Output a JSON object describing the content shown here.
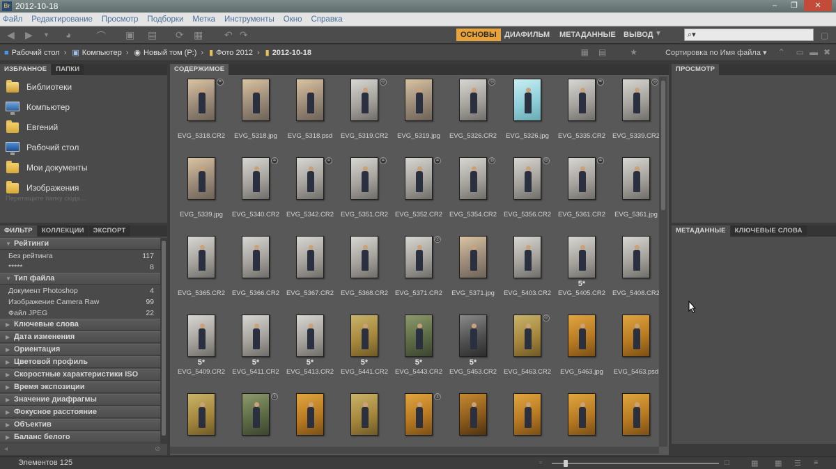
{
  "window": {
    "title": "2012-10-18",
    "app_icon": "Br"
  },
  "menu": [
    "Файл",
    "Редактирование",
    "Просмотр",
    "Подборки",
    "Метка",
    "Инструменты",
    "Окно",
    "Справка"
  ],
  "workspaces": [
    "ОСНОВЫ",
    "ДИАФИЛЬМ",
    "МЕТАДАННЫЕ",
    "ВЫВОД"
  ],
  "active_workspace": "ОСНОВЫ",
  "search": {
    "placeholder": ""
  },
  "path": [
    "Рабочий стол",
    "Компьютер",
    "Новый том (P:)",
    "Фото 2012",
    "2012-10-18"
  ],
  "sort_label": "Сортировка по Имя файла",
  "favorites_tabs": [
    "ИЗБРАННОЕ",
    "ПАПКИ"
  ],
  "favorites": [
    {
      "label": "Библиотеки",
      "icon": "libraries-icon"
    },
    {
      "label": "Компьютер",
      "icon": "computer-icon"
    },
    {
      "label": "Евгений",
      "icon": "user-folder-icon"
    },
    {
      "label": "Рабочий стол",
      "icon": "desktop-icon"
    },
    {
      "label": "Мои документы",
      "icon": "documents-icon"
    },
    {
      "label": "Изображения",
      "icon": "pictures-icon"
    }
  ],
  "favorites_hint": "Перетащите папку сюда...",
  "filter_tabs": [
    "ФИЛЬТР",
    "КОЛЛЕКЦИИ",
    "ЭКСПОРТ"
  ],
  "filter": {
    "ratings": {
      "title": "Рейтинги",
      "rows": [
        {
          "label": "Без рейтинга",
          "count": "117"
        },
        {
          "label": "*****",
          "count": "8"
        }
      ]
    },
    "file_type": {
      "title": "Тип файла",
      "rows": [
        {
          "label": "Документ Photoshop",
          "count": "4"
        },
        {
          "label": "Изображение Camera Raw",
          "count": "99"
        },
        {
          "label": "Файл JPEG",
          "count": "22"
        }
      ]
    },
    "collapsed": [
      "Ключевые слова",
      "Дата изменения",
      "Ориентация",
      "Цветовой профиль",
      "Скоростные характеристики ISO",
      "Время экспозиции",
      "Значение диафрагмы",
      "Фокусное расстояние",
      "Объектив",
      "Баланс белого"
    ]
  },
  "content_tab": "СОДЕРЖИМОЕ",
  "thumbnails": [
    {
      "name": "EVG_5318.CR2",
      "tone": "warm",
      "badge": "crop",
      "stars": ""
    },
    {
      "name": "EVG_5318.jpg",
      "tone": "warm",
      "badge": "",
      "stars": ""
    },
    {
      "name": "EVG_5318.psd",
      "tone": "warm",
      "badge": "",
      "stars": ""
    },
    {
      "name": "EVG_5319.CR2",
      "tone": "neutral",
      "badge": "dev",
      "stars": ""
    },
    {
      "name": "EVG_5319.jpg",
      "tone": "warm",
      "badge": "",
      "stars": ""
    },
    {
      "name": "EVG_5326.CR2",
      "tone": "neutral",
      "badge": "dev",
      "stars": ""
    },
    {
      "name": "EVG_5326.jpg",
      "tone": "cyan",
      "badge": "",
      "stars": ""
    },
    {
      "name": "EVG_5335.CR2",
      "tone": "neutral",
      "badge": "crop",
      "stars": ""
    },
    {
      "name": "EVG_5339.CR2",
      "tone": "neutral",
      "badge": "dev",
      "stars": ""
    },
    {
      "name": "EVG_5339.jpg",
      "tone": "warm",
      "badge": "",
      "stars": ""
    },
    {
      "name": "EVG_5340.CR2",
      "tone": "neutral",
      "badge": "crop",
      "stars": ""
    },
    {
      "name": "EVG_5342.CR2",
      "tone": "neutral",
      "badge": "crop",
      "stars": ""
    },
    {
      "name": "EVG_5351.CR2",
      "tone": "neutral",
      "badge": "crop",
      "stars": ""
    },
    {
      "name": "EVG_5352.CR2",
      "tone": "neutral",
      "badge": "crop",
      "stars": ""
    },
    {
      "name": "EVG_5354.CR2",
      "tone": "neutral",
      "badge": "dev",
      "stars": ""
    },
    {
      "name": "EVG_5356.CR2",
      "tone": "neutral",
      "badge": "dev",
      "stars": ""
    },
    {
      "name": "EVG_5361.CR2",
      "tone": "neutral",
      "badge": "crop",
      "stars": ""
    },
    {
      "name": "EVG_5361.jpg",
      "tone": "neutral",
      "badge": "",
      "stars": ""
    },
    {
      "name": "EVG_5365.CR2",
      "tone": "neutral",
      "badge": "",
      "stars": ""
    },
    {
      "name": "EVG_5366.CR2",
      "tone": "neutral",
      "badge": "",
      "stars": ""
    },
    {
      "name": "EVG_5367.CR2",
      "tone": "neutral",
      "badge": "",
      "stars": ""
    },
    {
      "name": "EVG_5368.CR2",
      "tone": "neutral",
      "badge": "",
      "stars": ""
    },
    {
      "name": "EVG_5371.CR2",
      "tone": "neutral",
      "badge": "dev",
      "stars": ""
    },
    {
      "name": "EVG_5371.jpg",
      "tone": "warm",
      "badge": "",
      "stars": ""
    },
    {
      "name": "EVG_5403.CR2",
      "tone": "neutral",
      "badge": "",
      "stars": ""
    },
    {
      "name": "EVG_5405.CR2",
      "tone": "neutral",
      "badge": "",
      "stars": "5*"
    },
    {
      "name": "EVG_5408.CR2",
      "tone": "neutral",
      "badge": "",
      "stars": ""
    },
    {
      "name": "EVG_5409.CR2",
      "tone": "neutral",
      "badge": "",
      "stars": "5*"
    },
    {
      "name": "EVG_5411.CR2",
      "tone": "neutral",
      "badge": "",
      "stars": "5*"
    },
    {
      "name": "EVG_5413.CR2",
      "tone": "neutral",
      "badge": "",
      "stars": "5*"
    },
    {
      "name": "EVG_5441.CR2",
      "tone": "autumn",
      "badge": "",
      "stars": "5*"
    },
    {
      "name": "EVG_5443.CR2",
      "tone": "green",
      "badge": "",
      "stars": "5*"
    },
    {
      "name": "EVG_5453.CR2",
      "tone": "dark",
      "badge": "",
      "stars": "5*"
    },
    {
      "name": "EVG_5463.CR2",
      "tone": "autumn",
      "badge": "dev",
      "stars": ""
    },
    {
      "name": "EVG_5463.jpg",
      "tone": "orange",
      "badge": "",
      "stars": ""
    },
    {
      "name": "EVG_5463.psd",
      "tone": "orange",
      "badge": "",
      "stars": ""
    },
    {
      "name": "",
      "tone": "autumn",
      "badge": "",
      "stars": ""
    },
    {
      "name": "",
      "tone": "green",
      "badge": "dev",
      "stars": ""
    },
    {
      "name": "",
      "tone": "orange",
      "badge": "",
      "stars": ""
    },
    {
      "name": "",
      "tone": "autumn",
      "badge": "",
      "stars": ""
    },
    {
      "name": "",
      "tone": "orange",
      "badge": "dev",
      "stars": ""
    },
    {
      "name": "",
      "tone": "dark-orange",
      "badge": "",
      "stars": ""
    },
    {
      "name": "",
      "tone": "orange",
      "badge": "",
      "stars": ""
    },
    {
      "name": "",
      "tone": "orange",
      "badge": "",
      "stars": ""
    },
    {
      "name": "",
      "tone": "orange",
      "badge": "",
      "stars": ""
    }
  ],
  "preview_tab": "ПРОСМОТР",
  "meta_tabs": [
    "МЕТАДАННЫЕ",
    "КЛЮЧЕВЫЕ СЛОВА"
  ],
  "status": {
    "count_text": "Элементов 125",
    "zoom_fraction": 0.07
  },
  "colors": {
    "accent": "#e8a43a",
    "panel": "#4a4a4a",
    "background": "#3a3a3a"
  }
}
